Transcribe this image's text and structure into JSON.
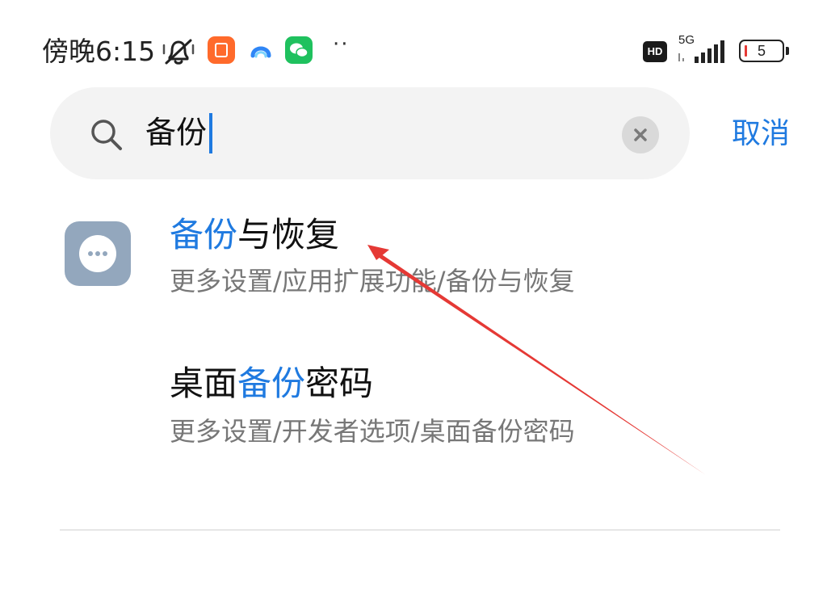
{
  "status_bar": {
    "time": "傍晚6:15",
    "hd_label": "HD",
    "network_label": "5G",
    "battery_level": "5",
    "more_indicator": "··",
    "icons": [
      "bell-off-icon",
      "mi-store-app-icon",
      "browser-app-icon",
      "wechat-app-icon",
      "hd-icon",
      "signal-icon",
      "battery-icon"
    ]
  },
  "search": {
    "value": "备份",
    "cancel_label": "取消",
    "icons": [
      "search-icon",
      "clear-icon"
    ]
  },
  "results": [
    {
      "title_highlight": "备份",
      "title_rest": "与恢复",
      "path": "更多设置/应用扩展功能/备份与恢复",
      "icon": "more-dots-icon"
    },
    {
      "title_prefix": "桌面",
      "title_highlight": "备份",
      "title_suffix": "密码",
      "path": "更多设置/开发者选项/桌面备份密码"
    }
  ],
  "colors": {
    "accent": "#1f7ae0",
    "annotation": "#e53935",
    "icon_bg": "#93a7bd"
  }
}
